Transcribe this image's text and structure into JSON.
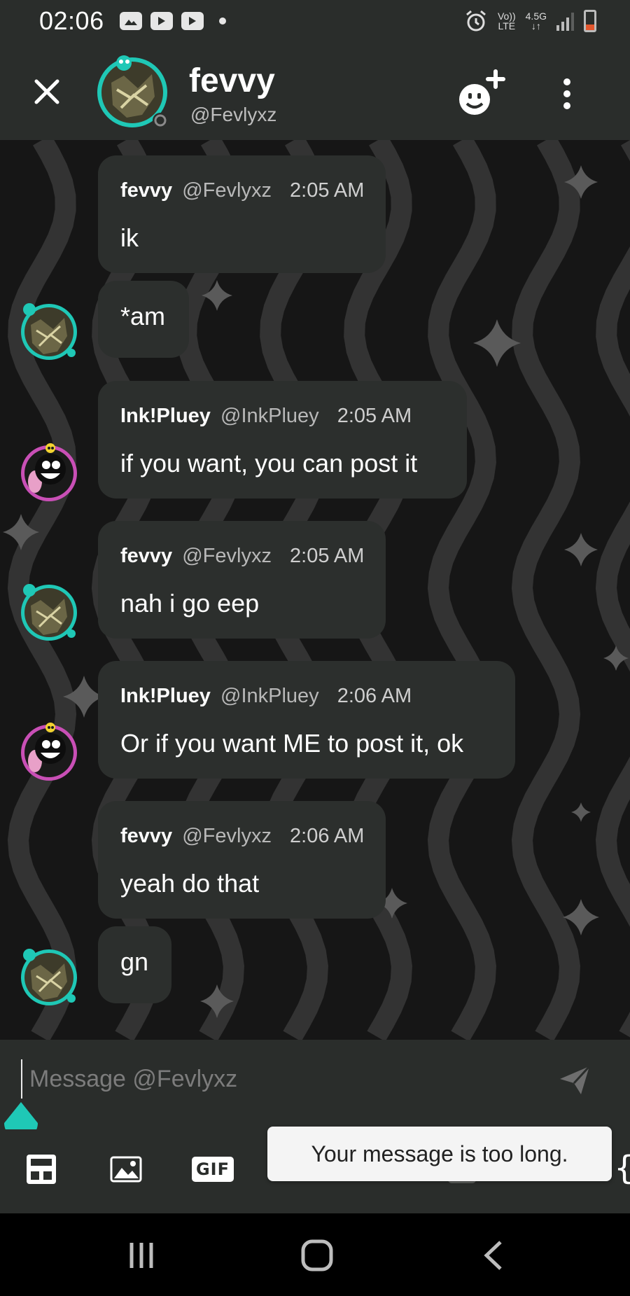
{
  "status_bar": {
    "time": "02:06",
    "network_top": "Vo))",
    "network_bottom": "LTE",
    "data_top": "4.5G",
    "data_bottom": "↓↑"
  },
  "header": {
    "display_name": "fevvy",
    "handle": "@Fevlyxz"
  },
  "messages": [
    {
      "author": "fevvy",
      "handle": "@Fevlyxz",
      "time": "2:05 AM",
      "text": "ik"
    },
    {
      "text": "*am"
    },
    {
      "author": "Ink!Pluey",
      "handle": "@InkPluey",
      "time": "2:05 AM",
      "text": "if you want, you can post it"
    },
    {
      "author": "fevvy",
      "handle": "@Fevlyxz",
      "time": "2:05 AM",
      "text": "nah i go eep"
    },
    {
      "author": "Ink!Pluey",
      "handle": "@InkPluey",
      "time": "2:06 AM",
      "text": "Or if you want ME to post it, ok"
    },
    {
      "author": "fevvy",
      "handle": "@Fevlyxz",
      "time": "2:06 AM",
      "text": "yeah do that"
    },
    {
      "text": "gn"
    }
  ],
  "composer": {
    "placeholder": "Message @Fevlyxz",
    "value": ""
  },
  "toolbar": {
    "gif_label": "GIF",
    "extra_label": "{"
  },
  "toast": {
    "text": "Your message is too long."
  },
  "colors": {
    "bar": "#2a2d2b",
    "bubble": "#2c2f2d",
    "accent": "#1fc8b6",
    "toast_bg": "#f4f4f4"
  }
}
